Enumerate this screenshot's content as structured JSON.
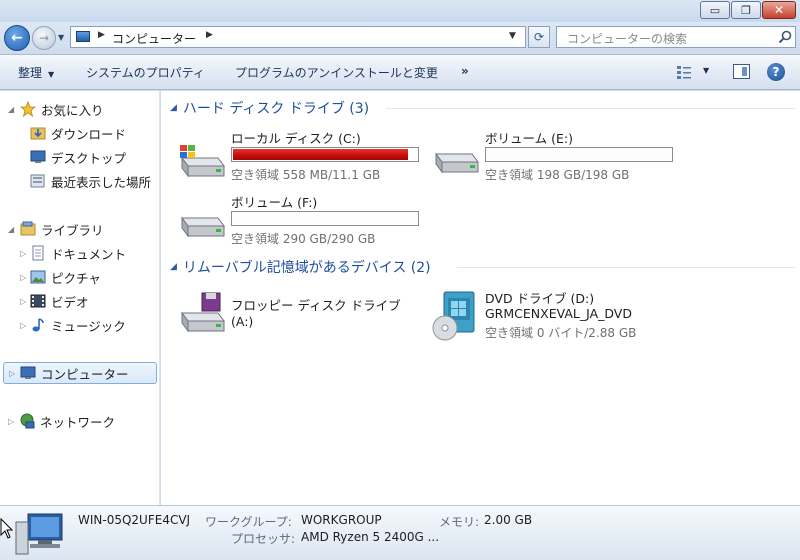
{
  "titlebar": {
    "minimize_glyph": "▭",
    "maximize_glyph": "❐",
    "close_glyph": "✕"
  },
  "address": {
    "back_glyph": "←",
    "forward_glyph": "→",
    "path_text": "コンピューター",
    "search_placeholder": "コンピューターの検索"
  },
  "toolbar": {
    "organize": "整理",
    "system_properties": "システムのプロパティ",
    "uninstall": "プログラムのアンインストールと変更",
    "more": "»",
    "help": "?"
  },
  "nav": {
    "favorites": {
      "label": "お気に入り",
      "items": [
        {
          "label": "ダウンロード"
        },
        {
          "label": "デスクトップ"
        },
        {
          "label": "最近表示した場所"
        }
      ]
    },
    "libraries": {
      "label": "ライブラリ",
      "items": [
        {
          "label": "ドキュメント"
        },
        {
          "label": "ピクチャ"
        },
        {
          "label": "ビデオ"
        },
        {
          "label": "ミュージック"
        }
      ]
    },
    "computer": {
      "label": "コンピューター"
    },
    "network": {
      "label": "ネットワーク"
    }
  },
  "content": {
    "hdd_group": {
      "title": "ハード ディスク ドライブ (3)"
    },
    "removable_group": {
      "title": "リムーバブル記憶域があるデバイス (2)"
    },
    "drives": [
      {
        "name": "ローカル ディスク (C:)",
        "space": "空き領域 558 MB/11.1 GB",
        "used_fraction": 0.95
      },
      {
        "name": "ボリューム (E:)",
        "space": "空き領域 198 GB/198 GB",
        "used_fraction": 0.0
      },
      {
        "name": "ボリューム (F:)",
        "space": "空き領域 290 GB/290 GB",
        "used_fraction": 0.0
      }
    ],
    "floppy": {
      "name": "フロッピー ディスク ドライブ",
      "letter": "(A:)"
    },
    "dvd": {
      "name": "DVD ドライブ (D:)",
      "label": "GRMCENXEVAL_JA_DVD",
      "space": "空き領域 0 バイト/2.88 GB"
    }
  },
  "status": {
    "computer_name": "WIN-05Q2UFE4CVJ",
    "workgroup_label": "ワークグループ:",
    "workgroup_value": "WORKGROUP",
    "memory_label": "メモリ:",
    "memory_value": "2.00 GB",
    "processor_label": "プロセッサ:",
    "processor_value": "AMD Ryzen 5 2400G ..."
  }
}
